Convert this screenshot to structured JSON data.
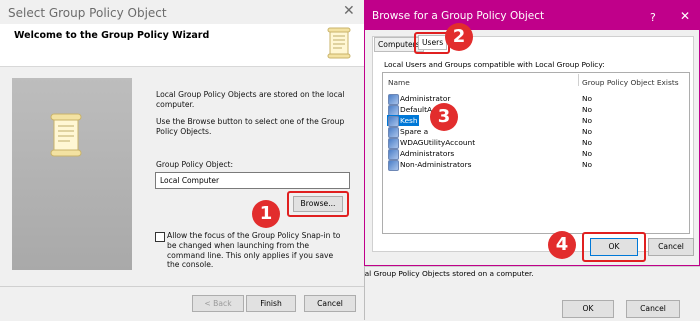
{
  "wizard": {
    "title": "Select Group Policy Object",
    "close_glyph": "✕",
    "welcome": "Welcome to the Group Policy Wizard",
    "desc1": "Local Group Policy Objects are stored on the local computer.",
    "desc2": "Use the Browse button to select one of the Group Policy Objects.",
    "gpo_label": "Group Policy Object:",
    "gpo_value": "Local Computer",
    "browse": "Browse...",
    "checkbox_text": "Allow the focus of the Group Policy Snap-in to be changed when launching from the command line.  This only applies if you save the console.",
    "back": "< Back",
    "finish": "Finish",
    "cancel": "Cancel"
  },
  "browse_dialog": {
    "title": "Browse for a Group Policy Object",
    "help": "?",
    "close_glyph": "✕",
    "tabs": [
      "Computers",
      "Users"
    ],
    "list_caption": "Local Users and Groups compatible with Local Group Policy:",
    "col_name": "Name",
    "col_exists": "Group Policy Object Exists",
    "rows": [
      {
        "name": "Administrator",
        "exists": "No"
      },
      {
        "name": "DefaultA",
        "exists": "No"
      },
      {
        "name": "Kesh",
        "exists": "No"
      },
      {
        "name": "Spare a",
        "exists": "No"
      },
      {
        "name": "WDAGUtilityAccount",
        "exists": "No"
      },
      {
        "name": "Administrators",
        "exists": "No"
      },
      {
        "name": "Non-Administrators",
        "exists": "No"
      }
    ],
    "ok": "OK",
    "cancel": "Cancel"
  },
  "background": {
    "status_text": "ocal Group Policy Objects stored on a computer.",
    "ok": "OK",
    "cancel": "Cancel"
  },
  "callouts": [
    "1",
    "2",
    "3",
    "4"
  ],
  "colors": {
    "accent": "#c0008a",
    "callout": "#e02020"
  }
}
